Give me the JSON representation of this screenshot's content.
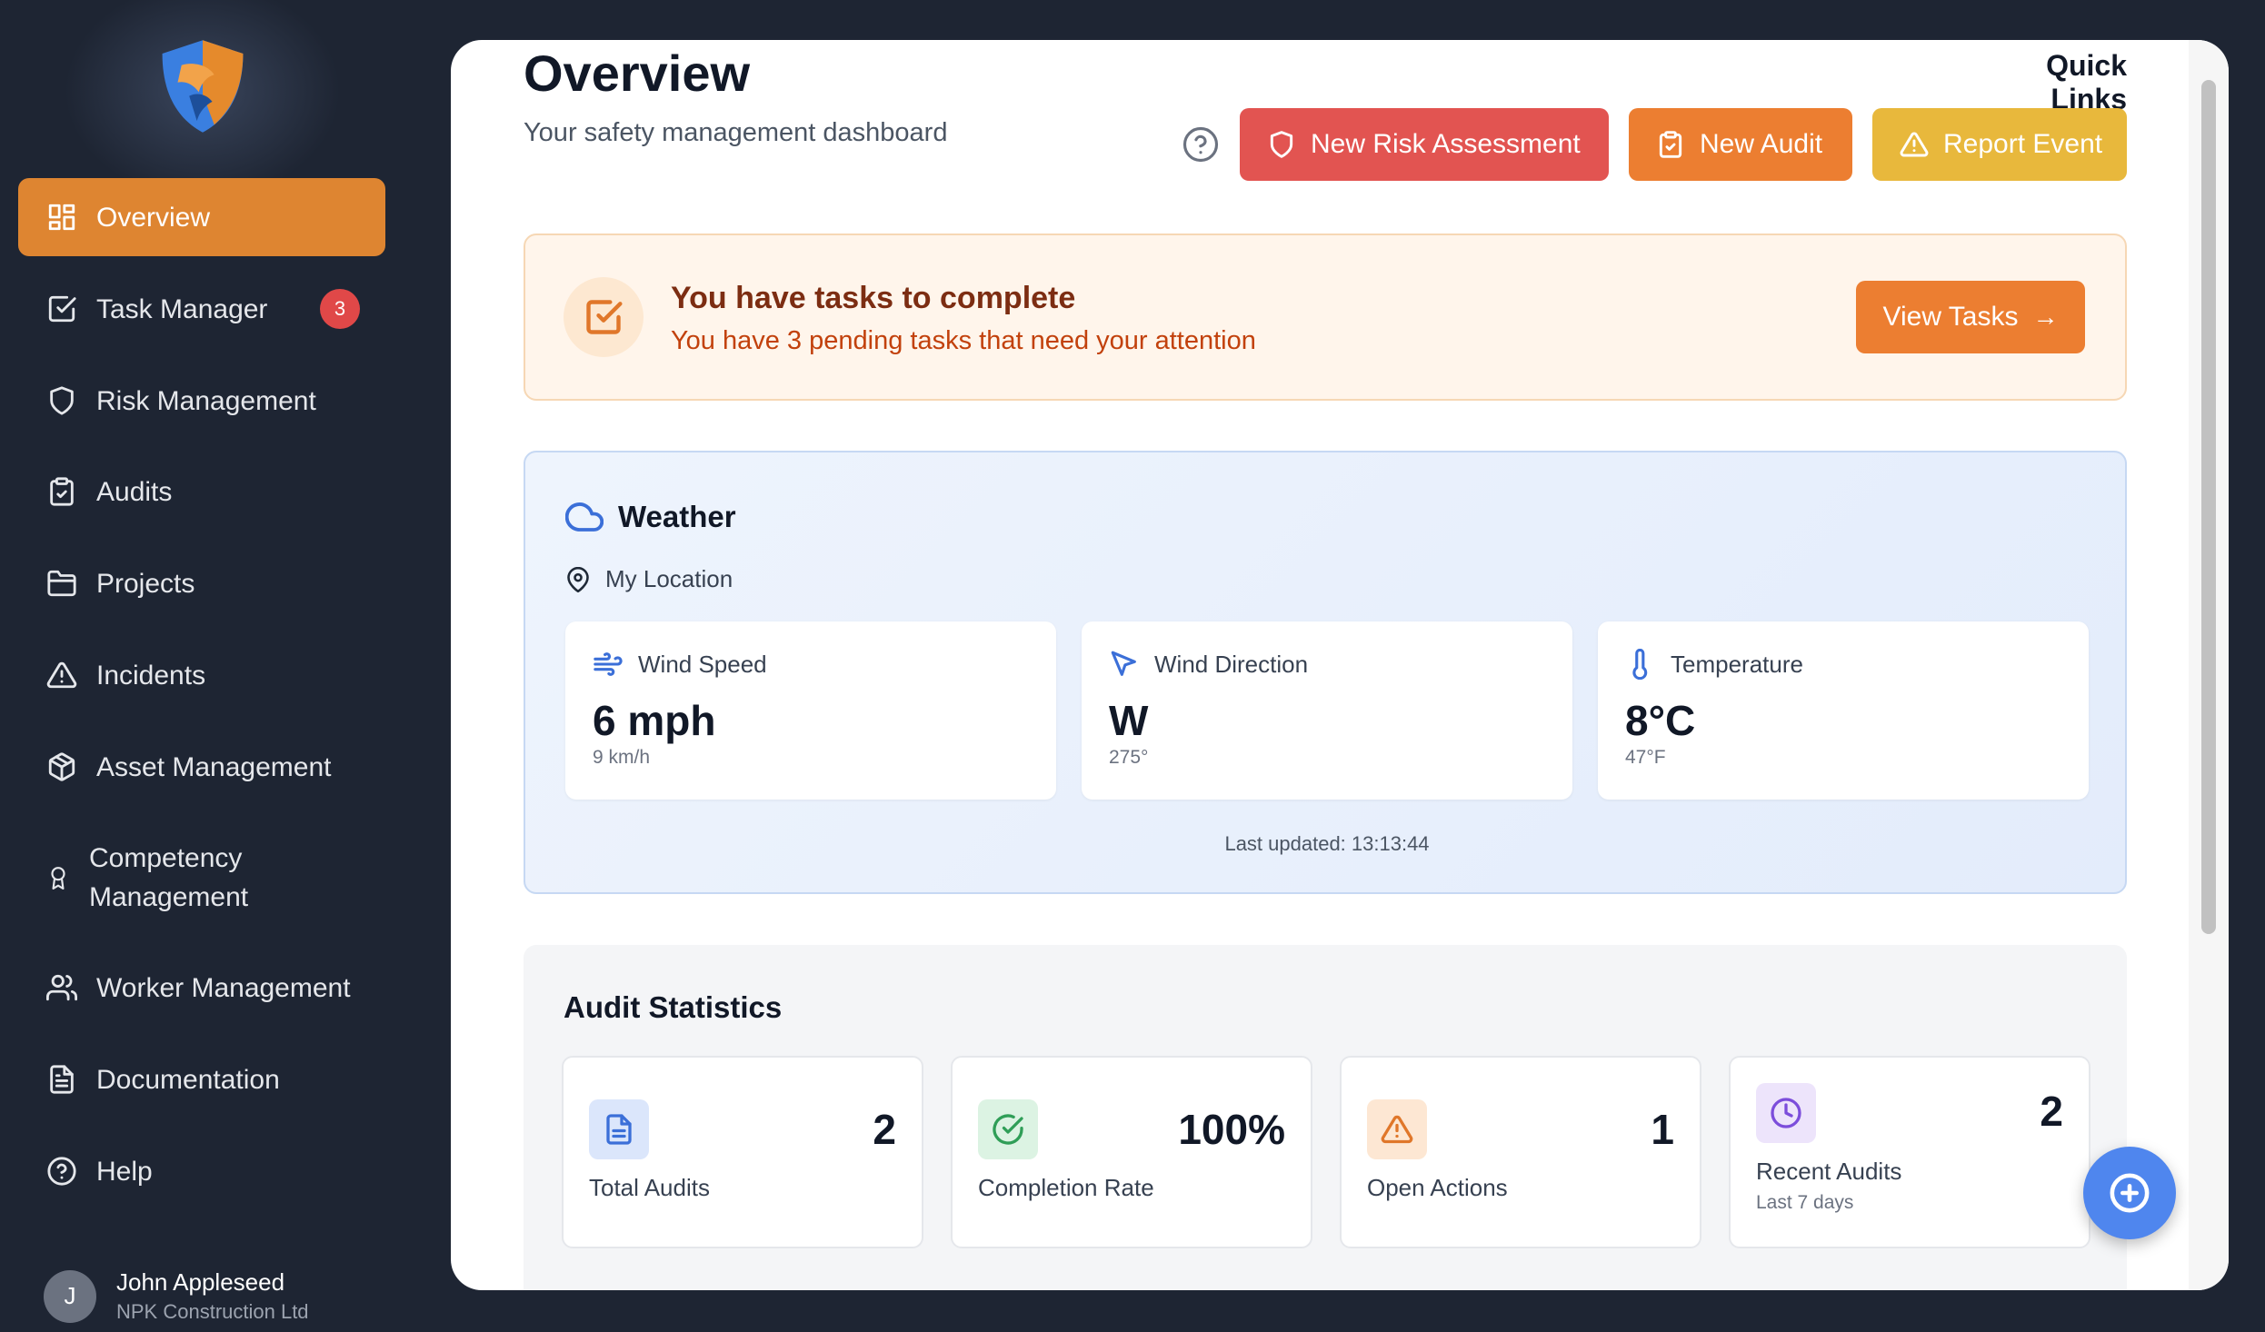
{
  "sidebar": {
    "logo_icon": "shield-logo-icon",
    "items": [
      {
        "label": "Overview",
        "icon": "dashboard-grid-icon",
        "active": true
      },
      {
        "label": "Task Manager",
        "icon": "checkbox-icon",
        "badge": "3"
      },
      {
        "label": "Risk Management",
        "icon": "shield-icon"
      },
      {
        "label": "Audits",
        "icon": "clipboard-icon"
      },
      {
        "label": "Projects",
        "icon": "folder-icon"
      },
      {
        "label": "Incidents",
        "icon": "warning-triangle-icon"
      },
      {
        "label": "Asset Management",
        "icon": "package-icon"
      },
      {
        "label": "Competency Management",
        "icon": "award-icon"
      },
      {
        "label": "Worker Management",
        "icon": "users-icon"
      },
      {
        "label": "Documentation",
        "icon": "document-icon"
      },
      {
        "label": "Help",
        "icon": "help-circle-icon"
      }
    ],
    "user": {
      "initial": "J",
      "name": "John Appleseed",
      "company": "NPK Construction Ltd"
    }
  },
  "header": {
    "title": "Overview",
    "subtitle": "Your safety management dashboard",
    "quick_links": "Quick Links",
    "buttons": {
      "risk": "New Risk Assessment",
      "audit": "New Audit",
      "report": "Report Event"
    }
  },
  "tasks": {
    "title": "You have tasks to complete",
    "subtitle": "You have 3 pending tasks that need your attention",
    "button": "View Tasks",
    "button_arrow": "→"
  },
  "weather": {
    "title": "Weather",
    "location": "My Location",
    "cards": [
      {
        "label": "Wind Speed",
        "value": "6 mph",
        "sub": "9 km/h",
        "icon": "wind-icon"
      },
      {
        "label": "Wind Direction",
        "value": "W",
        "sub": "275°",
        "icon": "navigation-pointer-icon"
      },
      {
        "label": "Temperature",
        "value": "8°C",
        "sub": "47°F",
        "icon": "thermometer-icon"
      }
    ],
    "last_updated": "Last updated: 13:13:44"
  },
  "audit_stats": {
    "title": "Audit Statistics",
    "cards": [
      {
        "label": "Total Audits",
        "value": "2",
        "icon": "file-text-icon"
      },
      {
        "label": "Completion Rate",
        "value": "100%",
        "icon": "check-circle-icon"
      },
      {
        "label": "Open Actions",
        "value": "1",
        "icon": "alert-triangle-icon"
      },
      {
        "label": "Recent Audits",
        "value": "2",
        "sub": "Last 7 days",
        "icon": "clock-icon"
      }
    ]
  },
  "colors": {
    "sidebar_bg": "#1e2533",
    "accent_orange": "#de8531",
    "danger_red": "#e25451",
    "warning_yellow": "#e8b83c",
    "info_blue": "#4f86ee"
  }
}
